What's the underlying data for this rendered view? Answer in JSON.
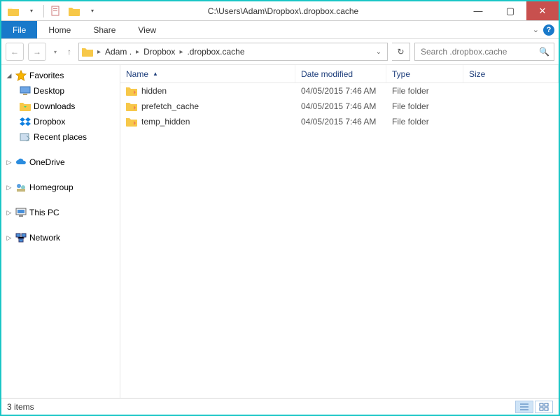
{
  "title": "C:\\Users\\Adam\\Dropbox\\.dropbox.cache",
  "ribbon": {
    "file": "File",
    "tabs": [
      "Home",
      "Share",
      "View"
    ]
  },
  "breadcrumb": {
    "segments": [
      "Adam .",
      "Dropbox",
      ".dropbox.cache"
    ]
  },
  "search": {
    "placeholder": "Search .dropbox.cache"
  },
  "nav": {
    "favorites": {
      "label": "Favorites",
      "items": [
        "Desktop",
        "Downloads",
        "Dropbox",
        "Recent places"
      ]
    },
    "onedrive": "OneDrive",
    "homegroup": "Homegroup",
    "thispc": "This PC",
    "network": "Network"
  },
  "columns": {
    "name": "Name",
    "date": "Date modified",
    "type": "Type",
    "size": "Size"
  },
  "rows": [
    {
      "name": "hidden",
      "date": "04/05/2015 7:46 AM",
      "type": "File folder"
    },
    {
      "name": "prefetch_cache",
      "date": "04/05/2015 7:46 AM",
      "type": "File folder"
    },
    {
      "name": "temp_hidden",
      "date": "04/05/2015 7:46 AM",
      "type": "File folder"
    }
  ],
  "status": "3 items"
}
